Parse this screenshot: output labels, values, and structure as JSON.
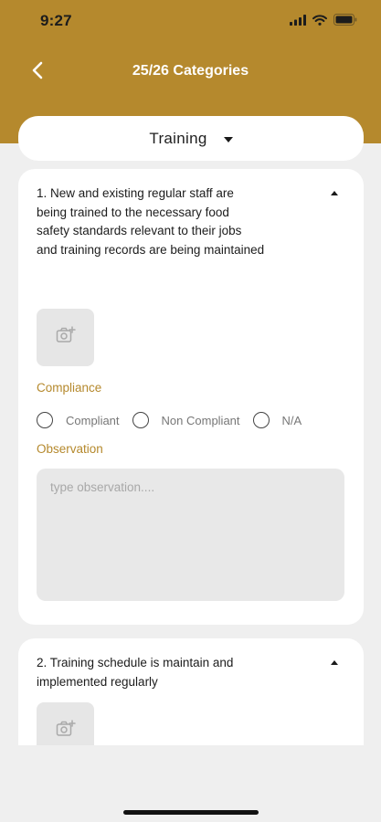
{
  "status_bar": {
    "time": "9:27",
    "icons": [
      "signal-icon",
      "wifi-icon",
      "battery-icon"
    ]
  },
  "nav": {
    "back_icon": "chevron-left-icon",
    "title": "25/26 Categories"
  },
  "category_select": {
    "selected": "Training",
    "icon": "caret-down-icon"
  },
  "questions": [
    {
      "text": "1. New and existing regular staff are being trained to the necessary food safety standards relevant to their jobs and training records are being maintained",
      "expanded": true,
      "photo_icon": "add-photo-icon",
      "compliance_label": "Compliance",
      "compliance_options": [
        "Compliant",
        "Non Compliant",
        "N/A"
      ],
      "selected_option": null,
      "observation_label": "Observation",
      "observation_placeholder": "type observation....",
      "observation_value": ""
    },
    {
      "text": "2. Training schedule is maintain and implemented regularly",
      "expanded": true,
      "photo_icon": "add-photo-icon"
    }
  ],
  "colors": {
    "brand": "#b5892d",
    "background": "#efefef",
    "card": "#ffffff",
    "input_fill": "#e8e8e8"
  }
}
